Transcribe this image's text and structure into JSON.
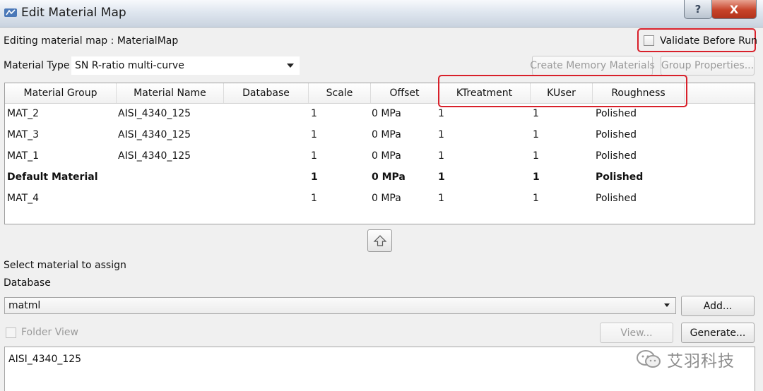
{
  "window": {
    "title": "Edit Material Map",
    "help_glyph": "?",
    "close_glyph": "X"
  },
  "header": {
    "editing_label": "Editing material map : MaterialMap",
    "validate_label": "Validate Before Run",
    "validate_checked": false,
    "material_type_label": "Material Type",
    "material_type_value": "SN R-ratio multi-curve",
    "create_memory_label": "Create Memory Materials",
    "group_properties_label": "Group Properties..."
  },
  "table": {
    "columns": [
      "Material Group",
      "Material Name",
      "Database",
      "Scale",
      "Offset",
      "KTreatment",
      "KUser",
      "Roughness"
    ],
    "rows": [
      {
        "group": "MAT_2",
        "name": "AISI_4340_125",
        "database": "",
        "scale": "1",
        "offset": "0 MPa",
        "ktreatment": "1",
        "kuser": "1",
        "roughness": "Polished",
        "bold": false
      },
      {
        "group": "MAT_3",
        "name": "AISI_4340_125",
        "database": "",
        "scale": "1",
        "offset": "0 MPa",
        "ktreatment": "1",
        "kuser": "1",
        "roughness": "Polished",
        "bold": false
      },
      {
        "group": "MAT_1",
        "name": "AISI_4340_125",
        "database": "",
        "scale": "1",
        "offset": "0 MPa",
        "ktreatment": "1",
        "kuser": "1",
        "roughness": "Polished",
        "bold": false
      },
      {
        "group": "Default Material",
        "name": "",
        "database": "",
        "scale": "1",
        "offset": "0 MPa",
        "ktreatment": "1",
        "kuser": "1",
        "roughness": "Polished",
        "bold": true
      },
      {
        "group": "MAT_4",
        "name": "",
        "database": "",
        "scale": "1",
        "offset": "0 MPa",
        "ktreatment": "1",
        "kuser": "1",
        "roughness": "Polished",
        "bold": false
      }
    ]
  },
  "assign": {
    "select_label": "Select material to assign",
    "database_label": "Database",
    "database_value": "matml",
    "add_label": "Add...",
    "folder_view_label": "Folder View",
    "view_label": "View...",
    "generate_label": "Generate...",
    "materials": [
      "AISI_4340_125"
    ]
  },
  "watermark": {
    "text": "艾羽科技"
  },
  "colors": {
    "highlight": "#d8202a",
    "close_button": "#c7432a"
  }
}
